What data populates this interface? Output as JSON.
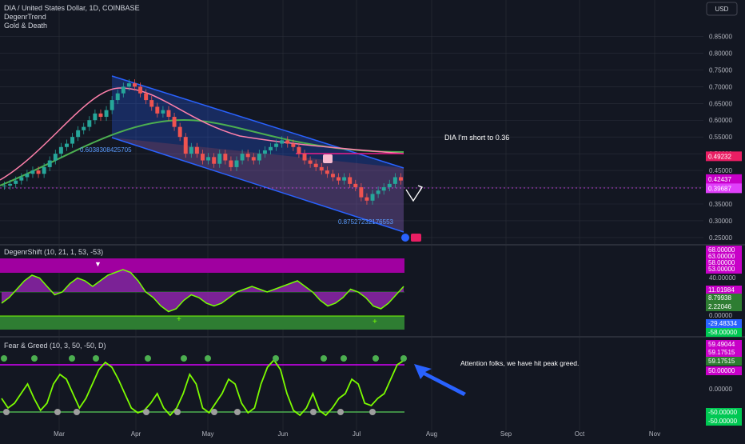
{
  "header": {
    "symbol_line": "DIA / United States Dollar, 1D, COINBASE",
    "indicator_1": "DegenrTrend",
    "indicator_2": "Gold & Death",
    "currency_button": "USD"
  },
  "colors": {
    "background": "#131722",
    "grid": "#2a2e39",
    "up_candle": "#26a69a",
    "down_candle": "#ef5350",
    "channel_fill": "#3b5bdb",
    "channel_line": "#2962ff",
    "ma_pink": "#e91e8c",
    "ma_green": "#4caf50",
    "oscillator_green": "#76ff03",
    "oscillator_magenta": "#c800c8",
    "fg_line": "#7cfc00",
    "fg_upper": "#d500f9",
    "arrow_blue": "#2962ff"
  },
  "chart_data": [
    {
      "type": "candlestick",
      "title": "DIA / United States Dollar, 1D, COINBASE",
      "x_ticks": [
        "Mar",
        "Apr",
        "May",
        "Jun",
        "Jul",
        "Aug",
        "Sep",
        "Oct",
        "Nov"
      ],
      "y_ticks": [
        "0.85000",
        "0.80000",
        "0.75000",
        "0.70000",
        "0.65000",
        "0.60000",
        "0.55000",
        "0.50000",
        "0.45000",
        "0.40000",
        "0.35000",
        "0.30000",
        "0.25000"
      ],
      "ylim": [
        0.245,
        0.875
      ],
      "close_series": [
        0.405,
        0.41,
        0.42,
        0.43,
        0.44,
        0.45,
        0.44,
        0.46,
        0.48,
        0.5,
        0.52,
        0.53,
        0.55,
        0.57,
        0.58,
        0.6,
        0.62,
        0.61,
        0.63,
        0.66,
        0.68,
        0.7,
        0.71,
        0.7,
        0.68,
        0.66,
        0.64,
        0.62,
        0.63,
        0.61,
        0.58,
        0.55,
        0.5,
        0.52,
        0.5,
        0.48,
        0.49,
        0.47,
        0.5,
        0.48,
        0.46,
        0.48,
        0.5,
        0.49,
        0.48,
        0.5,
        0.51,
        0.52,
        0.53,
        0.54,
        0.53,
        0.52,
        0.5,
        0.48,
        0.47,
        0.46,
        0.45,
        0.44,
        0.43,
        0.42,
        0.43,
        0.41,
        0.4,
        0.37,
        0.36,
        0.38,
        0.39,
        0.4,
        0.41,
        0.43,
        0.42
      ],
      "price_labels": [
        {
          "text": "0.49232",
          "color": "#e91e63"
        },
        {
          "text": "0.42437",
          "color": "#c800c8"
        },
        {
          "text": "0.39687",
          "color": "#e040fb"
        }
      ],
      "channel_labels": [
        "0.6038308425705",
        "0.87527232176553"
      ],
      "annotation": "DIA I'm short to 0.36"
    },
    {
      "type": "line",
      "title": "DegenrShift (10, 21, 1, 53, -53)",
      "right_labels": [
        {
          "text": "68.00000",
          "color": "#c800c8"
        },
        {
          "text": "63.00000",
          "color": "#c800c8"
        },
        {
          "text": "58.00000",
          "color": "#c800c8"
        },
        {
          "text": "53.00000",
          "color": "#c800c8"
        },
        {
          "text": "11.01984",
          "color": "#c800c8"
        },
        {
          "text": "8.79938",
          "color": "#2e7d32"
        },
        {
          "text": "2.22046",
          "color": "#2e7d32"
        },
        {
          "text": "-29.48334",
          "color": "#2962ff"
        },
        {
          "text": "-58.00000",
          "color": "#00c853"
        }
      ],
      "plain_labels": [
        "40.00000",
        "0.00000"
      ],
      "values": [
        -20,
        -10,
        5,
        20,
        30,
        25,
        10,
        -5,
        0,
        15,
        25,
        20,
        10,
        20,
        30,
        35,
        40,
        35,
        20,
        0,
        -10,
        -25,
        -35,
        -30,
        -15,
        -5,
        -10,
        -20,
        -25,
        -20,
        -10,
        0,
        5,
        10,
        5,
        0,
        5,
        10,
        15,
        20,
        10,
        0,
        -15,
        -25,
        -20,
        -10,
        5,
        0,
        -10,
        -25,
        -30,
        -20,
        -5,
        10
      ]
    },
    {
      "type": "line",
      "title": "Fear & Greed (10, 3, 50, -50, D)",
      "right_labels": [
        {
          "text": "59.49044",
          "color": "#c800c8"
        },
        {
          "text": "59.17515",
          "color": "#c800c8"
        },
        {
          "text": "59.17515",
          "color": "#2e7d32"
        },
        {
          "text": "50.00000",
          "color": "#c800c8"
        },
        {
          "text": "-50.00000",
          "color": "#00c853"
        },
        {
          "text": "-50.00000",
          "color": "#00c853"
        }
      ],
      "plain_labels": [
        "0.00000"
      ],
      "values": [
        -20,
        -40,
        -30,
        -10,
        10,
        -20,
        -45,
        -30,
        10,
        30,
        20,
        -10,
        -40,
        -20,
        10,
        40,
        55,
        45,
        20,
        -10,
        -40,
        -50,
        -45,
        -30,
        -10,
        -40,
        -55,
        -40,
        -10,
        30,
        10,
        -40,
        -50,
        -30,
        -10,
        20,
        10,
        -30,
        -50,
        -40,
        10,
        45,
        60,
        40,
        -10,
        -45,
        -55,
        -40,
        -10,
        -45,
        -55,
        -40,
        -20,
        -10,
        20,
        10,
        -30,
        -35,
        -20,
        -10,
        20,
        50,
        59
      ],
      "annotation": "Attention folks, we have hit peak greed."
    }
  ]
}
